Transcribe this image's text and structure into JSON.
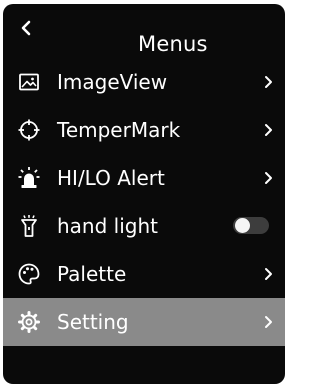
{
  "header": {
    "back_icon": "chevron-left-icon",
    "title": "Menus"
  },
  "menu": {
    "items": [
      {
        "label": "ImageView",
        "icon": "image-icon",
        "control": "chevron-right",
        "selected": false
      },
      {
        "label": "TemperMark",
        "icon": "crosshair-icon",
        "control": "chevron-right",
        "selected": false
      },
      {
        "label": "HI/LO Alert",
        "icon": "alarm-light-icon",
        "control": "chevron-right",
        "selected": false
      },
      {
        "label": "hand light",
        "icon": "flashlight-icon",
        "control": "toggle",
        "toggle_on": false,
        "selected": false
      },
      {
        "label": "Palette",
        "icon": "palette-icon",
        "control": "chevron-right",
        "selected": false
      },
      {
        "label": "Setting",
        "icon": "gear-icon",
        "control": "chevron-right",
        "selected": true
      }
    ]
  },
  "colors": {
    "background": "#0a0a0a",
    "text": "#ffffff",
    "selected_row": "#8a8a8a",
    "toggle_track": "#3d3d3d",
    "toggle_knob": "#f5f5f5"
  }
}
